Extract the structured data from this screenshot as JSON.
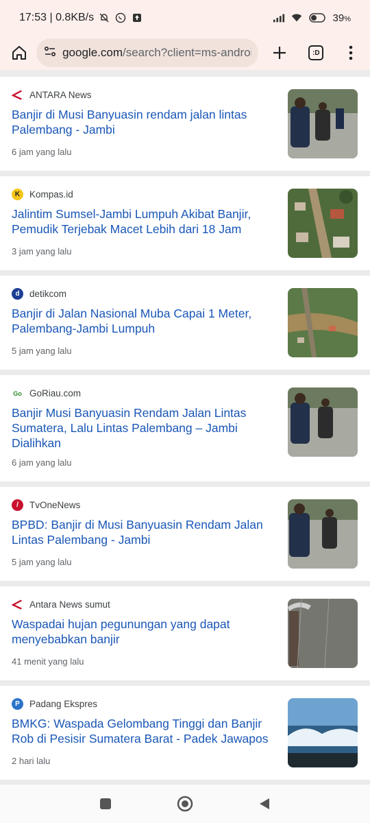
{
  "status_bar": {
    "time_speed": "17:53 | 0.8KB/s",
    "battery": "39"
  },
  "browser": {
    "url_domain": "google.com",
    "url_path": "/search?client=ms-android",
    "tab_switcher_label": ":D"
  },
  "articles": [
    {
      "source": "ANTARA News",
      "favicon": "antara-icon",
      "title": "Banjir di Musi Banyuasin rendam jalan lintas Palembang - Jambi",
      "time": "6 jam yang lalu",
      "thumb": "flood-road-people"
    },
    {
      "source": "Kompas.id",
      "favicon": "kompas-icon",
      "title": "Jalintim Sumsel-Jambi Lumpuh Akibat Banjir, Pemudik Terjebak Macet Lebih dari 18 Jam",
      "time": "3 jam yang lalu",
      "thumb": "aerial-flood-village"
    },
    {
      "source": "detikcom",
      "favicon": "detik-icon",
      "title": "Banjir di Jalan Nasional Muba Capai 1 Meter, Palembang-Jambi Lumpuh",
      "time": "5 jam yang lalu",
      "thumb": "aerial-flood-road"
    },
    {
      "source": "GoRiau.com",
      "favicon": "goriau-icon",
      "title": "Banjir Musi Banyuasin Rendam Jalan Lintas Sumatera, Lalu Lintas Palembang – Jambi Dialihkan",
      "time": "6 jam yang lalu",
      "thumb": "flood-road-people"
    },
    {
      "source": "TvOneNews",
      "favicon": "tvone-icon",
      "title": "BPBD: Banjir di Musi Banyuasin Rendam Jalan Lintas Palembang - Jambi",
      "time": "5 jam yang lalu",
      "thumb": "flood-road-people"
    },
    {
      "source": "Antara News sumut",
      "favicon": "antara-icon",
      "title": "Waspadai hujan pegunungan yang dapat menyebabkan banjir",
      "time": "41 menit yang lalu",
      "thumb": "rain-umbrella"
    },
    {
      "source": "Padang Ekspres",
      "favicon": "padang-ekspres-icon",
      "title": "BMKG: Waspada Gelombang Tinggi dan Banjir Rob di Pesisir Sumatera Barat - Padek Jawapos",
      "time": "2 hari lalu",
      "thumb": "ocean-waves"
    }
  ]
}
